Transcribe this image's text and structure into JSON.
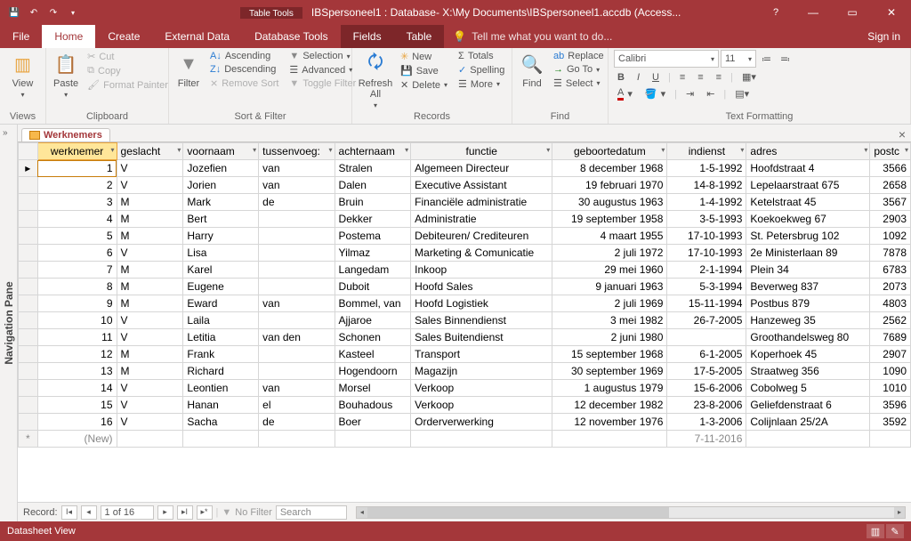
{
  "titlebar": {
    "table_tools": "Table Tools",
    "title": "IBSpersoneel1 : Database- X:\\My Documents\\IBSpersoneel1.accdb (Access...",
    "help": "?"
  },
  "menubar": {
    "file": "File",
    "home": "Home",
    "create": "Create",
    "external": "External Data",
    "dbtools": "Database Tools",
    "fields": "Fields",
    "table": "Table",
    "tell": "Tell me what you want to do...",
    "signin": "Sign in"
  },
  "ribbon": {
    "views": {
      "label": "Views",
      "view": "View"
    },
    "clipboard": {
      "label": "Clipboard",
      "paste": "Paste",
      "cut": "Cut",
      "copy": "Copy",
      "fp": "Format Painter"
    },
    "sortfilter": {
      "label": "Sort & Filter",
      "filter": "Filter",
      "asc": "Ascending",
      "desc": "Descending",
      "remove": "Remove Sort",
      "selection": "Selection",
      "advanced": "Advanced",
      "toggle": "Toggle Filter"
    },
    "records": {
      "label": "Records",
      "refresh": "Refresh All",
      "new": "New",
      "save": "Save",
      "delete": "Delete",
      "totals": "Totals",
      "spelling": "Spelling",
      "more": "More"
    },
    "find": {
      "label": "Find",
      "find": "Find",
      "replace": "Replace",
      "goto": "Go To",
      "select": "Select"
    },
    "text": {
      "label": "Text Formatting",
      "font": "Calibri",
      "size": "11"
    }
  },
  "navpane": {
    "label": "Navigation Pane"
  },
  "doctab": {
    "name": "Werknemers"
  },
  "columns": [
    "werknemer",
    "geslacht",
    "voornaam",
    "tussenvoeg:",
    "achternaam",
    "functie",
    "geboortedatum",
    "indienst",
    "adres",
    "postc"
  ],
  "rows": [
    {
      "id": "1",
      "g": "V",
      "vn": "Jozefien",
      "tv": "van",
      "an": "Stralen",
      "fn": "Algemeen Directeur",
      "gd": "8 december 1968",
      "ind": "1-5-1992",
      "adr": "Hoofdstraat 4",
      "pc": "3566"
    },
    {
      "id": "2",
      "g": "V",
      "vn": "Jorien",
      "tv": "van",
      "an": "Dalen",
      "fn": "Executive Assistant",
      "gd": "19 februari 1970",
      "ind": "14-8-1992",
      "adr": "Lepelaarstraat 675",
      "pc": "2658"
    },
    {
      "id": "3",
      "g": "M",
      "vn": "Mark",
      "tv": "de",
      "an": "Bruin",
      "fn": "Financiële administratie",
      "gd": "30 augustus 1963",
      "ind": "1-4-1992",
      "adr": "Ketelstraat 45",
      "pc": "3567"
    },
    {
      "id": "4",
      "g": "M",
      "vn": "Bert",
      "tv": "",
      "an": "Dekker",
      "fn": "Administratie",
      "gd": "19 september 1958",
      "ind": "3-5-1993",
      "adr": "Koekoekweg 67",
      "pc": "2903"
    },
    {
      "id": "5",
      "g": "M",
      "vn": "Harry",
      "tv": "",
      "an": "Postema",
      "fn": "Debiteuren/ Crediteuren",
      "gd": "4 maart 1955",
      "ind": "17-10-1993",
      "adr": "St. Petersbrug 102",
      "pc": "1092"
    },
    {
      "id": "6",
      "g": "V",
      "vn": "Lisa",
      "tv": "",
      "an": "Yilmaz",
      "fn": "Marketing & Comunicatie",
      "gd": "2 juli 1972",
      "ind": "17-10-1993",
      "adr": "2e Ministerlaan 89",
      "pc": "7878"
    },
    {
      "id": "7",
      "g": "M",
      "vn": "Karel",
      "tv": "",
      "an": "Langedam",
      "fn": "Inkoop",
      "gd": "29 mei 1960",
      "ind": "2-1-1994",
      "adr": "Plein 34",
      "pc": "6783"
    },
    {
      "id": "8",
      "g": "M",
      "vn": "Eugene",
      "tv": "",
      "an": "Duboit",
      "fn": "Hoofd Sales",
      "gd": "9 januari 1963",
      "ind": "5-3-1994",
      "adr": "Beverweg 837",
      "pc": "2073"
    },
    {
      "id": "9",
      "g": "M",
      "vn": "Eward",
      "tv": "van",
      "an": "Bommel, van",
      "fn": "Hoofd Logistiek",
      "gd": "2 juli 1969",
      "ind": "15-11-1994",
      "adr": "Postbus 879",
      "pc": "4803"
    },
    {
      "id": "10",
      "g": "V",
      "vn": "Laila",
      "tv": "",
      "an": "Ajjaroe",
      "fn": "Sales Binnendienst",
      "gd": "3 mei 1982",
      "ind": "26-7-2005",
      "adr": "Hanzeweg 35",
      "pc": "2562"
    },
    {
      "id": "11",
      "g": "V",
      "vn": "Letitia",
      "tv": "van den",
      "an": "Schonen",
      "fn": "Sales Buitendienst",
      "gd": "2 juni 1980",
      "ind": "",
      "adr": "Groothandelsweg 80",
      "pc": "7689"
    },
    {
      "id": "12",
      "g": "M",
      "vn": "Frank",
      "tv": "",
      "an": "Kasteel",
      "fn": "Transport",
      "gd": "15 september 1968",
      "ind": "6-1-2005",
      "adr": "Koperhoek 45",
      "pc": "2907"
    },
    {
      "id": "13",
      "g": "M",
      "vn": "Richard",
      "tv": "",
      "an": "Hogendoorn",
      "fn": "Magazijn",
      "gd": "30 september 1969",
      "ind": "17-5-2005",
      "adr": "Straatweg 356",
      "pc": "1090"
    },
    {
      "id": "14",
      "g": "V",
      "vn": "Leontien",
      "tv": "van",
      "an": "Morsel",
      "fn": "Verkoop",
      "gd": "1 augustus 1979",
      "ind": "15-6-2006",
      "adr": "Cobolweg 5",
      "pc": "1010"
    },
    {
      "id": "15",
      "g": "V",
      "vn": "Hanan",
      "tv": "el",
      "an": "Bouhadous",
      "fn": "Verkoop",
      "gd": "12 december 1982",
      "ind": "23-8-2006",
      "adr": "Geliefdenstraat 6",
      "pc": "3596"
    },
    {
      "id": "16",
      "g": "V",
      "vn": "Sacha",
      "tv": "de",
      "an": "Boer",
      "fn": "Orderverwerking",
      "gd": "12 november 1976",
      "ind": "1-3-2006",
      "adr": "Colijnlaan 25/2A",
      "pc": "3592"
    }
  ],
  "newrow": {
    "label": "(New)",
    "ind": "7-11-2016"
  },
  "recordnav": {
    "label": "Record:",
    "pos": "1 of 16",
    "nofilter": "No Filter",
    "search": "Search"
  },
  "status": {
    "view": "Datasheet View"
  }
}
